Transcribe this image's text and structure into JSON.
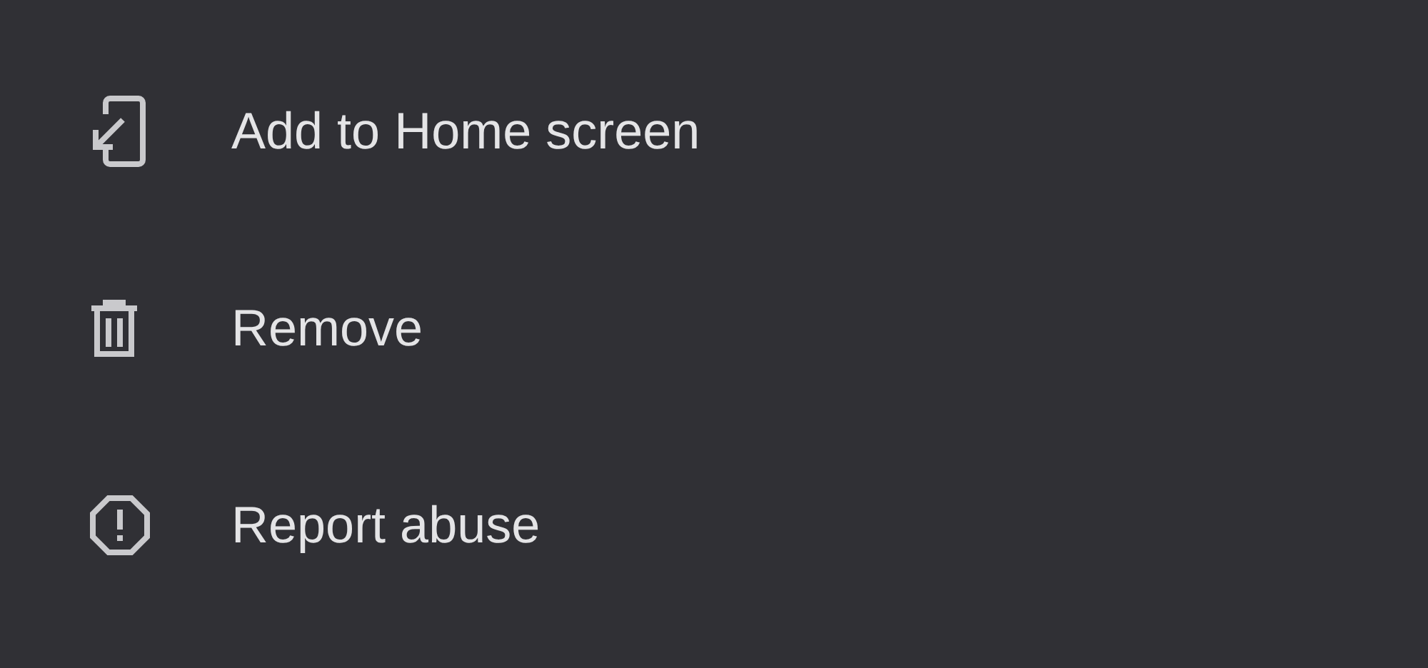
{
  "menu": {
    "items": [
      {
        "label": "Add to Home screen"
      },
      {
        "label": "Remove"
      },
      {
        "label": "Report abuse"
      }
    ]
  }
}
